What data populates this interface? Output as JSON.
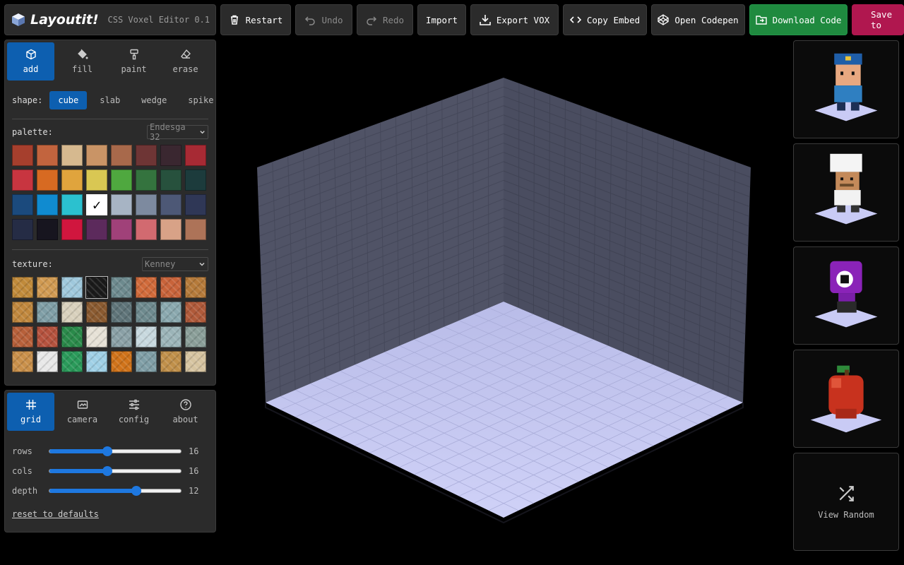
{
  "app": {
    "title": "Layoutit!",
    "subtitle": "CSS Voxel Editor 0.1"
  },
  "toolbar": {
    "restart": "Restart",
    "undo": "Undo",
    "redo": "Redo",
    "import": "Import",
    "export_vox": "Export VOX",
    "copy_embed": "Copy Embed",
    "open_codepen": "Open Codepen",
    "download_code": "Download Code",
    "save": "Save to"
  },
  "tools": [
    {
      "label": "add",
      "icon": "cube-icon",
      "active": true
    },
    {
      "label": "fill",
      "icon": "paint-bucket-icon",
      "active": false
    },
    {
      "label": "paint",
      "icon": "paint-roller-icon",
      "active": false
    },
    {
      "label": "erase",
      "icon": "eraser-icon",
      "active": false
    }
  ],
  "shape": {
    "label": "shape:",
    "options": [
      "cube",
      "slab",
      "wedge",
      "spike"
    ],
    "selected": "cube"
  },
  "palette": {
    "label": "palette:",
    "selected_name": "Endesga 32",
    "colors": [
      "#a63f2d",
      "#c2643e",
      "#d6b98f",
      "#c99466",
      "#a8694b",
      "#6e3535",
      "#3a2730",
      "#a72a34",
      "#c83540",
      "#d76a22",
      "#e0a43d",
      "#d9c753",
      "#4fa83f",
      "#34733e",
      "#27513d",
      "#1c3b3c",
      "#1b4a7d",
      "#108bd0",
      "#2bc1cf",
      "#ffffff",
      "#a7b4c4",
      "#7d8a9f",
      "#4d5876",
      "#2f3756",
      "#252c45",
      "#17151f",
      "#d0163e",
      "#5c2a5c",
      "#a04179",
      "#d26a70",
      "#d8a287",
      "#ad7358"
    ],
    "selected_index": 19
  },
  "texture": {
    "label": "texture:",
    "selected_name": "Kenney",
    "tiles": [
      "#c08a3a",
      "#d09a52",
      "#9fc8dc",
      "#1a1a1a",
      "#6d8a8e",
      "#d06a3a",
      "#c8633a",
      "#b57a3a",
      "#c0873d",
      "#7f9ea6",
      "#d8d0bc",
      "#8a5a30",
      "#5f7479",
      "#6e8a8e",
      "#8aa8ae",
      "#b05a3a",
      "#b7603a",
      "#b5523e",
      "#2a8a4a",
      "#e6e1d6",
      "#8aa0a6",
      "#c7d8de",
      "#9bb4b8",
      "#8a9e98",
      "#c9904a",
      "#e8e8e8",
      "#2a9a5a",
      "#9fd0e6",
      "#d0731a",
      "#7f9ea6",
      "#c0904a",
      "#d6c4a0"
    ],
    "selected_index": 3
  },
  "view_tabs": [
    {
      "label": "grid",
      "icon": "grid-icon",
      "active": true
    },
    {
      "label": "camera",
      "icon": "camera-icon",
      "active": false
    },
    {
      "label": "config",
      "icon": "sliders-icon",
      "active": false
    },
    {
      "label": "about",
      "icon": "help-icon",
      "active": false
    }
  ],
  "grid_settings": {
    "rows": {
      "label": "rows",
      "value": 16,
      "fraction": 0.44
    },
    "cols": {
      "label": "cols",
      "value": 16,
      "fraction": 0.44
    },
    "depth": {
      "label": "depth",
      "value": 12,
      "fraction": 0.66
    },
    "reset_label": "reset to defaults"
  },
  "gallery": {
    "items": [
      "police-officer-model",
      "chef-model",
      "purple-cyclops-model",
      "apple-model"
    ],
    "random_label": "View Random"
  },
  "colors": {
    "accent": "#0d5fb0",
    "download": "#1f8a3f",
    "save": "#b0174f",
    "wall": "#4c4f63",
    "floor": "#c5c8f0"
  }
}
